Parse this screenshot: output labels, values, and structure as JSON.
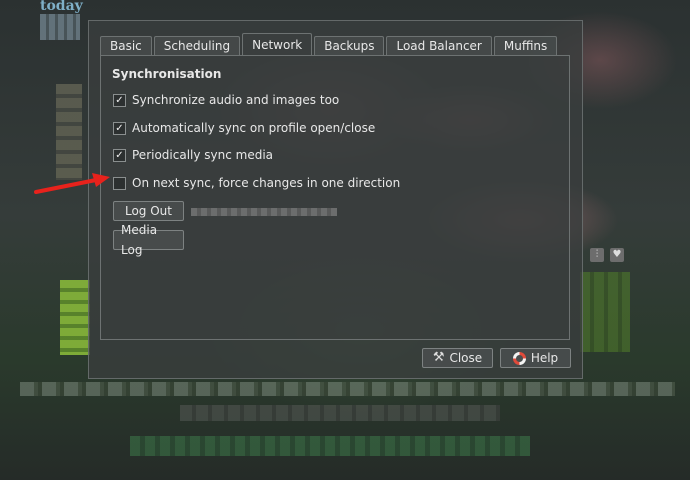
{
  "background": {
    "title": "today"
  },
  "tabs": [
    {
      "label": "Basic",
      "active": false
    },
    {
      "label": "Scheduling",
      "active": false
    },
    {
      "label": "Network",
      "active": true
    },
    {
      "label": "Backups",
      "active": false
    },
    {
      "label": "Load Balancer",
      "active": false
    },
    {
      "label": "Muffins",
      "active": false
    }
  ],
  "network": {
    "section_title": "Synchronisation",
    "options": [
      {
        "label": "Synchronize audio and images too",
        "checked": true
      },
      {
        "label": "Automatically sync on profile open/close",
        "checked": true
      },
      {
        "label": "Periodically sync media",
        "checked": true
      },
      {
        "label": "On next sync, force changes in one direction",
        "checked": false
      }
    ],
    "logout_label": "Log Out",
    "media_log_label": "Media Log"
  },
  "footer": {
    "close_label": "Close",
    "help_label": "Help"
  },
  "colors": {
    "annotation_arrow": "#e8221c",
    "dialog_bg": "#3a3e3e"
  },
  "icons": {
    "close": "broom-icon",
    "help": "lifebuoy-icon",
    "side_1": "equalizer-icon",
    "side_2": "heart-icon"
  }
}
